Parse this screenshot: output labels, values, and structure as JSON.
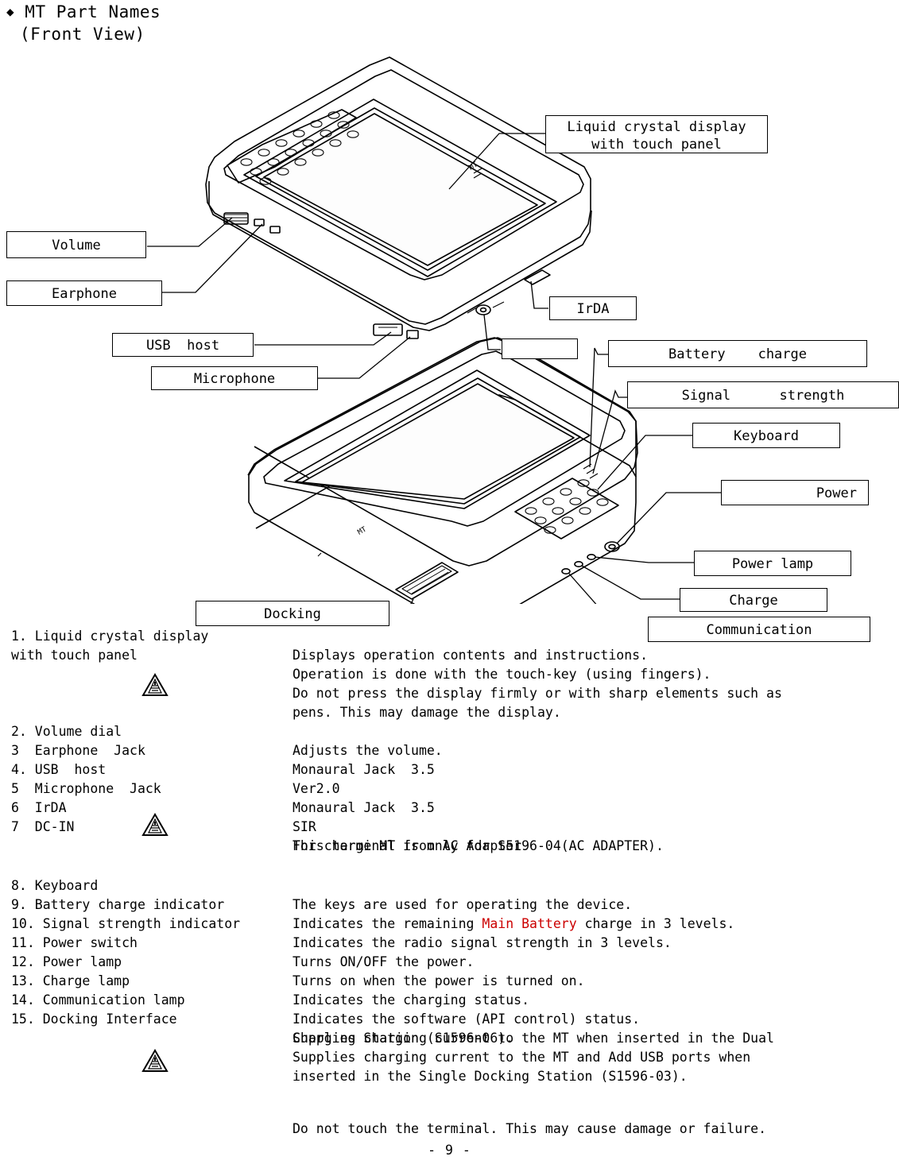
{
  "header": {
    "bullet": "◆",
    "title": "MT Part Names",
    "subtitle": "(Front View)"
  },
  "figure": {
    "callouts": [
      {
        "id": "lcd",
        "label": "Liquid crystal display\nwith touch panel"
      },
      {
        "id": "volume",
        "label": "Volume"
      },
      {
        "id": "earphone",
        "label": "Earphone"
      },
      {
        "id": "usb-host",
        "label": "USB  host"
      },
      {
        "id": "microphone",
        "label": "Microphone"
      },
      {
        "id": "irda",
        "label": "IrDA"
      },
      {
        "id": "dcin",
        "label": ""
      },
      {
        "id": "battery",
        "label": "Battery    charge"
      },
      {
        "id": "signal",
        "label": "Signal      strength"
      },
      {
        "id": "keyboard",
        "label": "Keyboard"
      },
      {
        "id": "power",
        "label": "Power"
      },
      {
        "id": "powerlamp",
        "label": "Power lamp"
      },
      {
        "id": "charge",
        "label": "Charge"
      },
      {
        "id": "comm",
        "label": "Communication"
      },
      {
        "id": "docking",
        "label": "Docking"
      }
    ]
  },
  "list": [
    {
      "num": "1. Liquid crystal display",
      "num2": "with touch panel",
      "desc": "Displays operation contents and instructions."
    },
    {
      "num": "",
      "desc": "Operation is done with the touch-key (using fingers)."
    },
    {
      "num": "",
      "desc": "Do not press the display firmly or with sharp elements such as"
    },
    {
      "num": "",
      "desc": "pens. This may damage the display."
    },
    {
      "num": "2. Volume dial",
      "desc": "Adjusts the volume."
    },
    {
      "num": "3  Earphone  Jack",
      "desc": "Monaural Jack  3.5"
    },
    {
      "num": "4. USB  host",
      "desc": "Ver2.0"
    },
    {
      "num": "5  Microphone  Jack",
      "desc": "Monaural Jack  3.5"
    },
    {
      "num": "6  IrDA",
      "desc": "SIR"
    },
    {
      "num": "7  DC-IN",
      "desc": "For charge MT from AC Adapter"
    },
    {
      "num": "",
      "desc": "This terminal is only for S5196-04(AC ADAPTER)."
    },
    {
      "num": "8. Keyboard",
      "desc": "The keys are used for operating the device."
    },
    {
      "num": "9. Battery charge indicator",
      "desc_pre": "Indicates the remaining ",
      "desc_hl": "Main Battery",
      "desc_post": " charge in 3 levels."
    },
    {
      "num": "10. Signal strength indicator",
      "desc": "Indicates the radio signal strength in 3 levels."
    },
    {
      "num": "11. Power switch",
      "desc": "Turns ON/OFF the power."
    },
    {
      "num": "12. Power lamp",
      "desc": "Turns on when the power is turned on."
    },
    {
      "num": "13. Charge lamp",
      "desc": "Indicates the charging status."
    },
    {
      "num": "14. Communication lamp",
      "desc": "Indicates the software (API control) status."
    },
    {
      "num": "15. Docking Interface",
      "desc": "Supplies charging current to the MT when inserted in the Dual"
    },
    {
      "num": "",
      "desc": "Charging Station (S1596-06)."
    },
    {
      "num": "",
      "desc": "Supplies charging current to the MT and Add USB ports when"
    },
    {
      "num": "",
      "desc": "inserted in the Single Docking Station (S1596-03)."
    },
    {
      "num": "",
      "desc": "Do not touch the terminal. This may cause damage or failure."
    }
  ],
  "footer": "- 9 -"
}
